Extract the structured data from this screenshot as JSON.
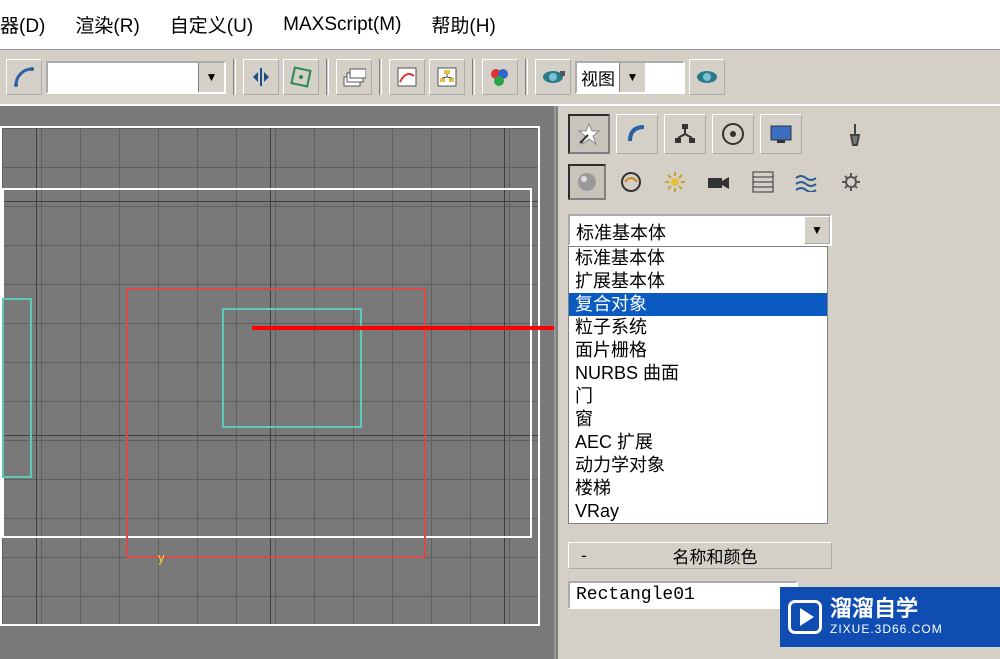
{
  "menu": {
    "items": [
      "器(D)",
      "渲染(R)",
      "自定义(U)",
      "MAXScript(M)",
      "帮助(H)"
    ]
  },
  "toolbar": {
    "view_label": "视图"
  },
  "panel": {
    "category_selected": "标准基本体",
    "type_list": [
      "标准基本体",
      "扩展基本体",
      "复合对象",
      "粒子系统",
      "面片栅格",
      "NURBS 曲面",
      "门",
      "窗",
      "AEC 扩展",
      "动力学对象",
      "楼梯",
      "VRay"
    ],
    "selected_index": 2,
    "rollup_name_color": "名称和颜色",
    "minus": "-",
    "object_name": "Rectangle01"
  },
  "axis": {
    "y": "y"
  },
  "brand": {
    "title": "溜溜自学",
    "url": "ZIXUE.3D66.COM"
  }
}
